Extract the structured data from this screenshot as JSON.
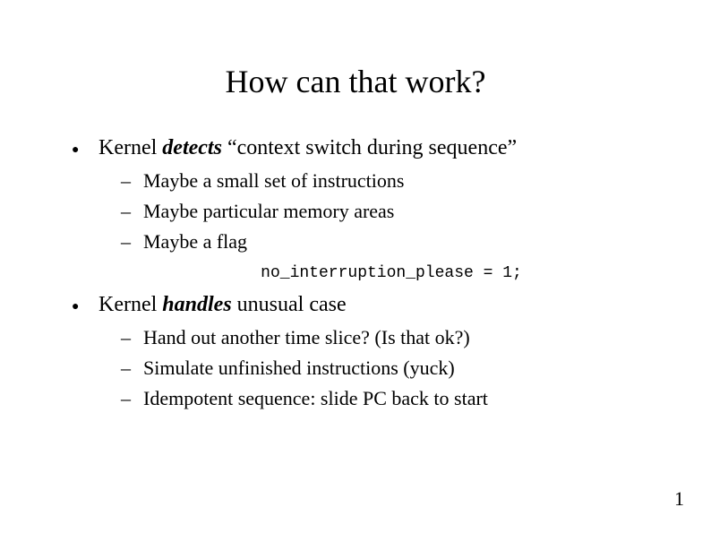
{
  "title": "How can that work?",
  "bullets": {
    "item1": {
      "pre": "Kernel ",
      "emph": "detects",
      "post": " “context switch during sequence”",
      "sub": {
        "a": "Maybe a small set of instructions",
        "b": "Maybe particular memory areas",
        "c": "Maybe a flag"
      }
    },
    "code": "no_interruption_please = 1;",
    "item2": {
      "pre": "Kernel ",
      "emph": "handles",
      "post": " unusual case",
      "sub": {
        "a": "Hand out another time slice? (Is that ok?)",
        "b": "Simulate unfinished instructions (yuck)",
        "c": "Idempotent sequence:  slide PC back to start"
      }
    }
  },
  "page_number": "1"
}
